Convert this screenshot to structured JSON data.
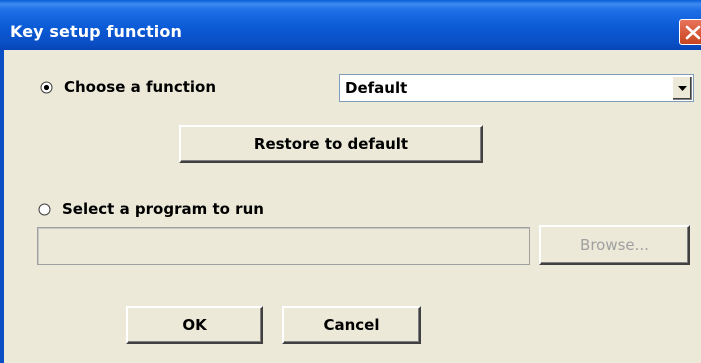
{
  "window": {
    "title": "Key setup function"
  },
  "choose_function": {
    "label": "Choose a function",
    "selected": true,
    "dropdown_value": "Default"
  },
  "restore_button": {
    "label": "Restore to default"
  },
  "select_program": {
    "label": "Select a program to run",
    "selected": false,
    "path_value": "",
    "browse_label": "Browse..."
  },
  "footer": {
    "ok_label": "OK",
    "cancel_label": "Cancel"
  },
  "colors": {
    "titlebar": "#0a4fc6",
    "dialog_bg": "#ece9d8",
    "close_button": "#d9532c"
  },
  "icons": {
    "close": "close-icon",
    "dropdown": "chevron-down-icon"
  }
}
